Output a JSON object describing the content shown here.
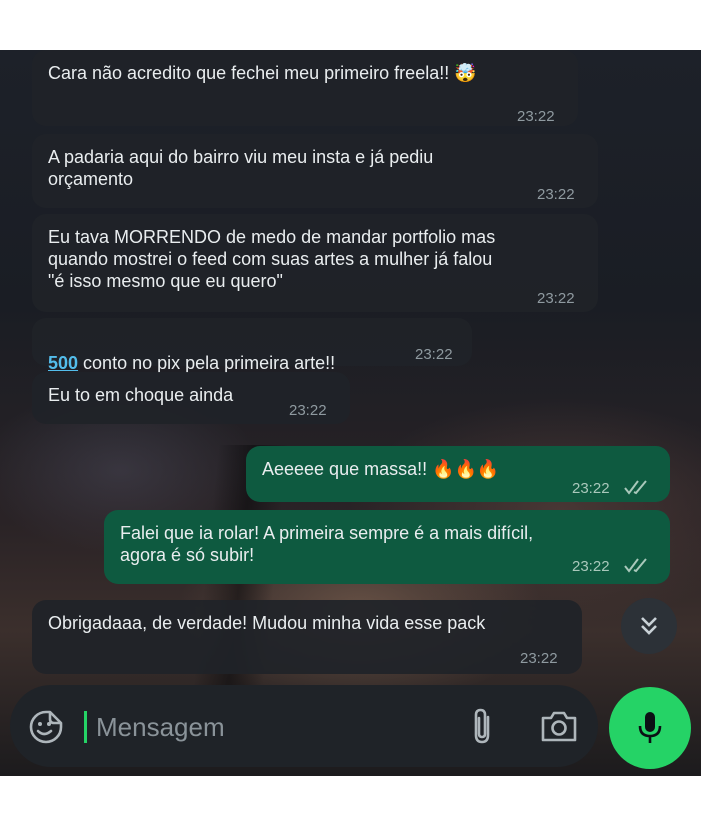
{
  "messages": [
    {
      "direction": "in",
      "text": "Cara não acredito que fechei meu primeiro freela!! 🤯",
      "time": "23:22"
    },
    {
      "direction": "in",
      "text": "A padaria aqui do bairro viu meu insta e já pediu\norçamento",
      "time": "23:22"
    },
    {
      "direction": "in",
      "text": "Eu tava MORRENDO de medo de mandar portfolio mas\nquando mostrei o feed com suas artes a mulher já falou\n\"é isso mesmo que eu quero\"",
      "time": "23:22"
    },
    {
      "direction": "in",
      "link_text": "500",
      "text": " conto no pix pela primeira arte!!",
      "time": "23:22"
    },
    {
      "direction": "in",
      "text": "Eu to em choque ainda",
      "time": "23:22"
    },
    {
      "direction": "out",
      "text": "Aeeeee que massa!! 🔥🔥🔥",
      "time": "23:22",
      "status": "read"
    },
    {
      "direction": "out",
      "text": "Falei que ia rolar! A primeira sempre é a mais difícil,\nagora é só subir!",
      "time": "23:22",
      "status": "read"
    },
    {
      "direction": "in",
      "text": "Obrigadaaa, de verdade! Mudou minha vida esse pack",
      "time": "23:22"
    }
  ],
  "composer": {
    "placeholder": "Mensagem",
    "emoji_icon": "sticker-emoji-icon",
    "attach_icon": "paperclip-icon",
    "camera_icon": "camera-icon"
  },
  "mic_icon": "microphone-icon",
  "scroll_icon": "double-chevron-down-icon",
  "colors": {
    "incoming_bubble": "#202328",
    "outgoing_bubble": "#0e5a40",
    "accent": "#25d366",
    "link": "#53bdeb"
  }
}
